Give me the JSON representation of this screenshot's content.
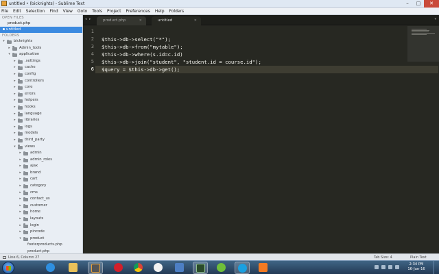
{
  "window": {
    "title": "untitled • (bicknights) - Sublime Text"
  },
  "menu": [
    "File",
    "Edit",
    "Selection",
    "Find",
    "View",
    "Goto",
    "Tools",
    "Project",
    "Preferences",
    "Help",
    "Folders"
  ],
  "sidebar": {
    "open_files_header": "OPEN FILES",
    "open_files": [
      {
        "label": "product.php",
        "active": false
      },
      {
        "label": "untitled",
        "active": true
      }
    ],
    "folders_header": "FOLDERS",
    "tree": [
      {
        "label": "bicknights",
        "depth": 0,
        "type": "folder",
        "expanded": true
      },
      {
        "label": "Admin_tools",
        "depth": 1,
        "type": "folder",
        "expanded": false
      },
      {
        "label": "application",
        "depth": 1,
        "type": "folder",
        "expanded": true
      },
      {
        "label": ".settings",
        "depth": 2,
        "type": "folder",
        "expanded": false
      },
      {
        "label": "cache",
        "depth": 2,
        "type": "folder",
        "expanded": false
      },
      {
        "label": "config",
        "depth": 2,
        "type": "folder",
        "expanded": false
      },
      {
        "label": "controllers",
        "depth": 2,
        "type": "folder",
        "expanded": false
      },
      {
        "label": "core",
        "depth": 2,
        "type": "folder",
        "expanded": false
      },
      {
        "label": "errors",
        "depth": 2,
        "type": "folder",
        "expanded": false
      },
      {
        "label": "helpers",
        "depth": 2,
        "type": "folder",
        "expanded": false
      },
      {
        "label": "hooks",
        "depth": 2,
        "type": "folder",
        "expanded": false
      },
      {
        "label": "language",
        "depth": 2,
        "type": "folder",
        "expanded": false
      },
      {
        "label": "libraries",
        "depth": 2,
        "type": "folder",
        "expanded": false
      },
      {
        "label": "logs",
        "depth": 2,
        "type": "folder",
        "expanded": false
      },
      {
        "label": "models",
        "depth": 2,
        "type": "folder",
        "expanded": false
      },
      {
        "label": "third_party",
        "depth": 2,
        "type": "folder",
        "expanded": false
      },
      {
        "label": "views",
        "depth": 2,
        "type": "folder",
        "expanded": true
      },
      {
        "label": "admin",
        "depth": 3,
        "type": "folder",
        "expanded": false
      },
      {
        "label": "admin_roles",
        "depth": 3,
        "type": "folder",
        "expanded": false
      },
      {
        "label": "ajax",
        "depth": 3,
        "type": "folder",
        "expanded": false
      },
      {
        "label": "brand",
        "depth": 3,
        "type": "folder",
        "expanded": false
      },
      {
        "label": "cart",
        "depth": 3,
        "type": "folder",
        "expanded": false
      },
      {
        "label": "category",
        "depth": 3,
        "type": "folder",
        "expanded": false
      },
      {
        "label": "cms",
        "depth": 3,
        "type": "folder",
        "expanded": false
      },
      {
        "label": "contact_us",
        "depth": 3,
        "type": "folder",
        "expanded": false
      },
      {
        "label": "customer",
        "depth": 3,
        "type": "folder",
        "expanded": false
      },
      {
        "label": "home",
        "depth": 3,
        "type": "folder",
        "expanded": false
      },
      {
        "label": "layouts",
        "depth": 3,
        "type": "folder",
        "expanded": false
      },
      {
        "label": "login",
        "depth": 3,
        "type": "folder",
        "expanded": false
      },
      {
        "label": "pincode",
        "depth": 3,
        "type": "folder",
        "expanded": false
      },
      {
        "label": "product",
        "depth": 3,
        "type": "folder",
        "expanded": true
      },
      {
        "label": "footerproducts.php",
        "depth": 4,
        "type": "file"
      },
      {
        "label": "product.php",
        "depth": 4,
        "type": "file"
      }
    ]
  },
  "tabs": [
    {
      "label": "product.php",
      "active": false
    },
    {
      "label": "untitled",
      "active": true
    }
  ],
  "editor": {
    "current_line": 6,
    "lines": [
      "",
      "$this->db->select(\"*\");",
      "$this->db->from(\"mytable\");",
      "$this->db->where(s.id=c.id)",
      "$this->db->join(\"student\", \"student.id = course.id\");",
      "$query = $this->db->get();"
    ]
  },
  "status": {
    "position": "Line 6, Column 27",
    "tab_size": "Tab Size: 4",
    "syntax": "Plain Text"
  },
  "taskbar": {
    "apps": [
      "ie-icon",
      "explorer-icon",
      "sublime-icon",
      "opera-icon",
      "chrome-icon",
      "smiley-icon",
      "virtualbox-icon",
      "terminal-icon",
      "utorrent-icon",
      "skype-icon",
      "xampp-icon"
    ],
    "time": "2:34 PM",
    "date": "16-Jun-16"
  },
  "colors": {
    "editor_bg": "#272822",
    "sidebar_bg": "#e9eef4",
    "selection_blue": "#3b8ae0",
    "code_text": "#f8f8f2"
  }
}
